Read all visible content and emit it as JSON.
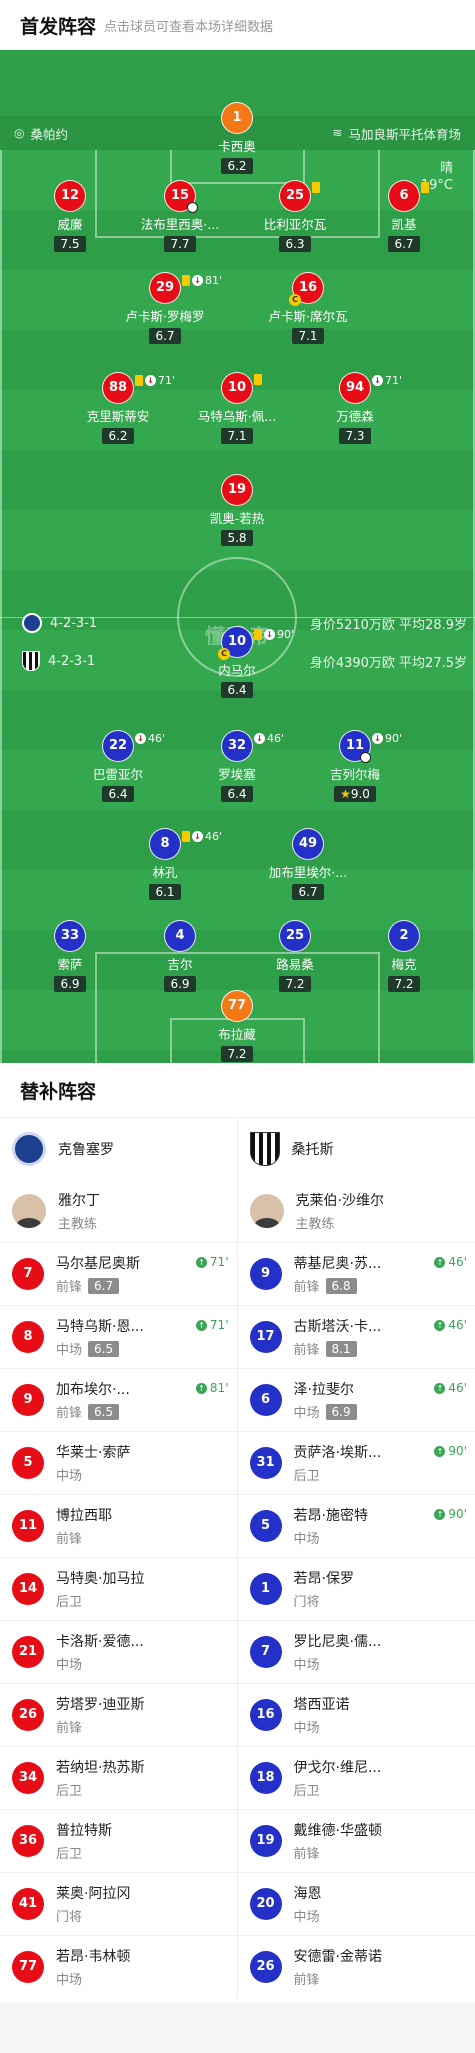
{
  "header": {
    "title": "首发阵容",
    "subtitle": "点击球员可查看本场详细数据"
  },
  "venue": {
    "coach_label": "桑帕约",
    "stadium": "马加良斯平托体育场"
  },
  "weather": {
    "condition": "晴",
    "temp": "19°C"
  },
  "home": {
    "formation": "4-2-3-1",
    "value": "身价5210万欧 平均28.9岁"
  },
  "away": {
    "formation": "4-2-3-1",
    "value": "身价4390万欧 平均27.5岁"
  },
  "watermark": "懂球帝",
  "pitch_players": [
    {
      "num": "1",
      "name": "卡西奥",
      "rating": "6.2",
      "team": "gk"
    },
    {
      "num": "12",
      "name": "威廉",
      "rating": "7.5",
      "team": "red"
    },
    {
      "num": "15",
      "name": "法布里西奥·...",
      "rating": "7.7",
      "team": "red"
    },
    {
      "num": "25",
      "name": "比利亚尔瓦",
      "rating": "6.3",
      "team": "red"
    },
    {
      "num": "6",
      "name": "凯基",
      "rating": "6.7",
      "team": "red"
    },
    {
      "num": "29",
      "name": "卢卡斯·罗梅罗",
      "rating": "6.7",
      "team": "red",
      "sub": "81'"
    },
    {
      "num": "16",
      "name": "卢卡斯·席尔瓦",
      "rating": "7.1",
      "team": "red"
    },
    {
      "num": "88",
      "name": "克里斯蒂安",
      "rating": "6.2",
      "team": "red",
      "sub": "71'"
    },
    {
      "num": "10",
      "name": "马特乌斯·佩...",
      "rating": "7.1",
      "team": "red"
    },
    {
      "num": "94",
      "name": "万德森",
      "rating": "7.3",
      "team": "red",
      "sub": "71'"
    },
    {
      "num": "19",
      "name": "凯奥-若热",
      "rating": "5.8",
      "team": "red"
    },
    {
      "num": "10",
      "name": "内马尔",
      "rating": "6.4",
      "team": "blue",
      "sub": "90'"
    },
    {
      "num": "22",
      "name": "巴雷亚尔",
      "rating": "6.4",
      "team": "blue",
      "sub": "46'"
    },
    {
      "num": "32",
      "name": "罗埃塞",
      "rating": "6.4",
      "team": "blue",
      "sub": "46'"
    },
    {
      "num": "11",
      "name": "吉列尔梅",
      "rating": "9.0",
      "team": "blue",
      "sub": "90'"
    },
    {
      "num": "8",
      "name": "林孔",
      "rating": "6.1",
      "team": "blue",
      "sub": "46'"
    },
    {
      "num": "49",
      "name": "加布里埃尔·...",
      "rating": "6.7",
      "team": "blue"
    },
    {
      "num": "33",
      "name": "索萨",
      "rating": "6.9",
      "team": "blue"
    },
    {
      "num": "4",
      "name": "吉尔",
      "rating": "6.9",
      "team": "blue"
    },
    {
      "num": "25",
      "name": "路易桑",
      "rating": "7.2",
      "team": "blue"
    },
    {
      "num": "2",
      "name": "梅克",
      "rating": "7.2",
      "team": "blue"
    },
    {
      "num": "77",
      "name": "布拉藏",
      "rating": "7.2",
      "team": "gk"
    }
  ],
  "bench_title": "替补阵容",
  "bench": {
    "left_team": "克鲁塞罗",
    "right_team": "桑托斯",
    "left_coach": {
      "name": "雅尔丁",
      "role": "主教练"
    },
    "right_coach": {
      "name": "克莱伯·沙维尔",
      "role": "主教练"
    },
    "left": [
      {
        "num": "7",
        "name": "马尔基尼奥斯",
        "pos": "前锋",
        "rating": "6.7",
        "time": "71'"
      },
      {
        "num": "8",
        "name": "马特乌斯·恩...",
        "pos": "中场",
        "rating": "6.5",
        "time": "71'"
      },
      {
        "num": "9",
        "name": "加布埃尔·...",
        "pos": "前锋",
        "rating": "6.5",
        "time": "81'"
      },
      {
        "num": "5",
        "name": "华莱士·索萨",
        "pos": "中场"
      },
      {
        "num": "11",
        "name": "博拉西耶",
        "pos": "前锋"
      },
      {
        "num": "14",
        "name": "马特奥·加马拉",
        "pos": "后卫"
      },
      {
        "num": "21",
        "name": "卡洛斯·爱德...",
        "pos": "中场"
      },
      {
        "num": "26",
        "name": "劳塔罗·迪亚斯",
        "pos": "前锋"
      },
      {
        "num": "34",
        "name": "若纳坦·热苏斯",
        "pos": "后卫"
      },
      {
        "num": "36",
        "name": "普拉特斯",
        "pos": "后卫"
      },
      {
        "num": "41",
        "name": "莱奥·阿拉冈",
        "pos": "门将"
      },
      {
        "num": "77",
        "name": "若昂·韦林顿",
        "pos": "中场"
      }
    ],
    "right": [
      {
        "num": "9",
        "name": "蒂基尼奥·苏...",
        "pos": "前锋",
        "rating": "6.8",
        "time": "46'"
      },
      {
        "num": "17",
        "name": "古斯塔沃·卡...",
        "pos": "前锋",
        "rating": "8.1",
        "time": "46'"
      },
      {
        "num": "6",
        "name": "泽·拉斐尔",
        "pos": "中场",
        "rating": "6.9",
        "time": "46'"
      },
      {
        "num": "31",
        "name": "贡萨洛·埃斯...",
        "pos": "后卫",
        "time": "90'"
      },
      {
        "num": "5",
        "name": "若昂·施密特",
        "pos": "中场",
        "time": "90'"
      },
      {
        "num": "1",
        "name": "若昂·保罗",
        "pos": "门将"
      },
      {
        "num": "7",
        "name": "罗比尼奥·儒...",
        "pos": "中场"
      },
      {
        "num": "16",
        "name": "塔西亚诺",
        "pos": "中场"
      },
      {
        "num": "18",
        "name": "伊戈尔·维尼...",
        "pos": "后卫"
      },
      {
        "num": "19",
        "name": "戴维德·华盛顿",
        "pos": "前锋"
      },
      {
        "num": "20",
        "name": "海恩",
        "pos": "中场"
      },
      {
        "num": "26",
        "name": "安德雷·金蒂诺",
        "pos": "前锋"
      }
    ]
  }
}
